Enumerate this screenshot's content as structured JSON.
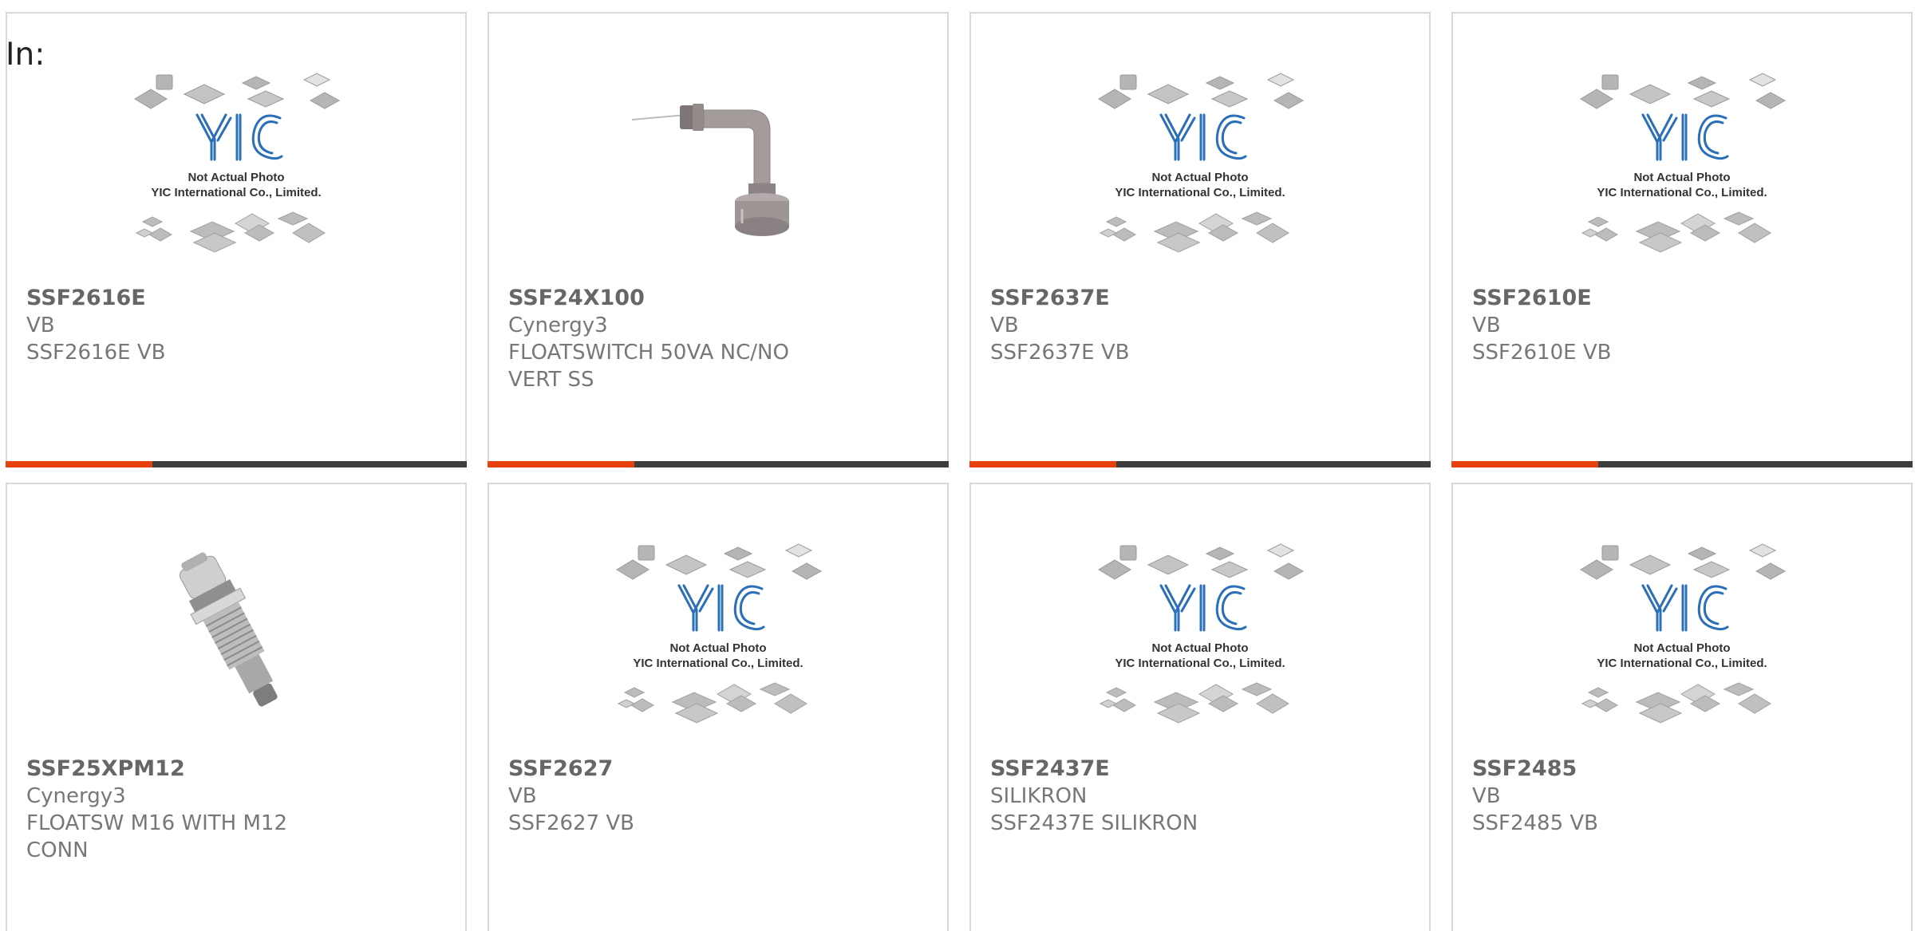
{
  "header": {
    "label": "In:"
  },
  "placeholder": {
    "line1": "Not Actual Photo",
    "line2": "YIC International Co., Limited.",
    "logo": "YIC"
  },
  "colors": {
    "accent": "#e8410f",
    "bar": "#3d3d3d",
    "border": "#d9d9d9",
    "text": "#777777"
  },
  "products": [
    {
      "part": "SSF2616E",
      "manufacturer": "VB",
      "description": "SSF2616E VB",
      "image": "yic-placeholder"
    },
    {
      "part": "SSF24X100",
      "manufacturer": "Cynergy3",
      "description": "FLOATSWITCH 50VA NC/NO VERT SS",
      "image": "float-switch-vertical-photo"
    },
    {
      "part": "SSF2637E",
      "manufacturer": "VB",
      "description": "SSF2637E VB",
      "image": "yic-placeholder"
    },
    {
      "part": "SSF2610E",
      "manufacturer": "VB",
      "description": "SSF2610E VB",
      "image": "yic-placeholder"
    },
    {
      "part": "SSF25XPM12",
      "manufacturer": "Cynergy3",
      "description": "FLOATSW M16 WITH M12 CONN",
      "image": "float-switch-connector-photo"
    },
    {
      "part": "SSF2627",
      "manufacturer": "VB",
      "description": "SSF2627 VB",
      "image": "yic-placeholder"
    },
    {
      "part": "SSF2437E",
      "manufacturer": "SILIKRON",
      "description": "SSF2437E SILIKRON",
      "image": "yic-placeholder"
    },
    {
      "part": "SSF2485",
      "manufacturer": "VB",
      "description": "SSF2485 VB",
      "image": "yic-placeholder"
    }
  ]
}
